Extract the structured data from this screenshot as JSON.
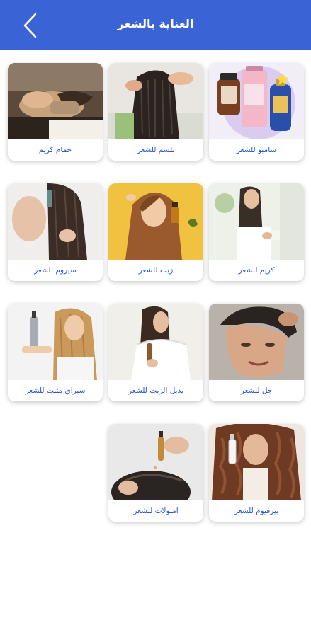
{
  "header": {
    "title": "العناية بالشعر",
    "back_icon": "chevron-left-icon",
    "color": "#3a63d6"
  },
  "accent": "#2c55c9",
  "categories": [
    {
      "label": "شامبو للشعر",
      "image": "shampoo-bottles"
    },
    {
      "label": "بلسم للشعر",
      "image": "hair-conditioner"
    },
    {
      "label": "حمام كريم",
      "image": "hair-bath-cream"
    },
    {
      "label": "كريم للشعر",
      "image": "hair-cream"
    },
    {
      "label": "زيت للشعر",
      "image": "hair-oil"
    },
    {
      "label": "سيروم للشعر",
      "image": "hair-serum"
    },
    {
      "label": "جل للشعر",
      "image": "hair-gel"
    },
    {
      "label": "بديل الزيت للشعر",
      "image": "oil-replacement"
    },
    {
      "label": "سبراي مثبت للشعر",
      "image": "hair-spray"
    },
    {
      "label": "بيرفيوم للشعر",
      "image": "hair-perfume"
    },
    {
      "label": "امبولات للشعر",
      "image": "hair-ampoules"
    }
  ]
}
